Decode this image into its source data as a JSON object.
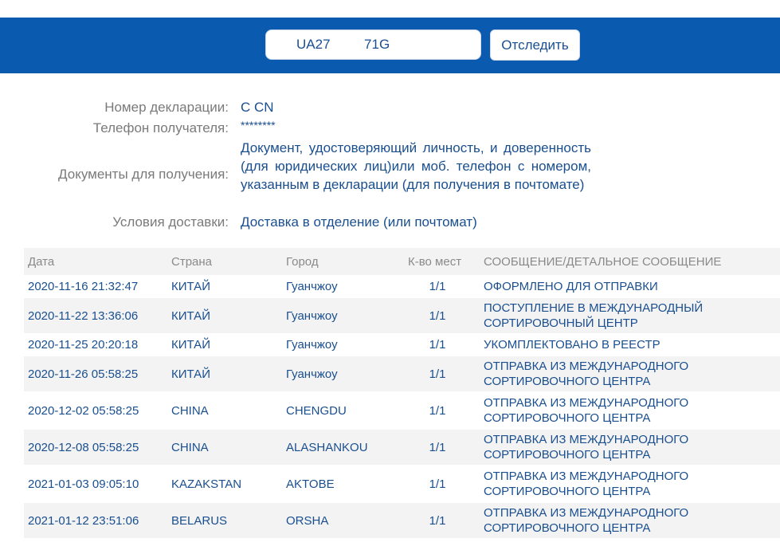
{
  "tracking": {
    "value": "UA27         71G",
    "button_label": "Отследить"
  },
  "info": {
    "declaration_label": "Номер декларации:",
    "declaration_value": "C           CN",
    "phone_label": "Телефон получателя:",
    "phone_value": "********",
    "documents_label": "Документы для получения:",
    "documents_value": "Документ, удостоверяющий личность, и доверенность (для юридических лиц)или моб. телефон с номером, указанным в декларации (для получения в почтомате)",
    "delivery_label": "Условия доставки:",
    "delivery_value": "Доставка в отделение (или почтомат)"
  },
  "table": {
    "headers": [
      "Дата",
      "Страна",
      "Город",
      "К-во мест",
      "СООБЩЕНИЕ/ДЕТАЛЬНОЕ СООБЩЕНИЕ"
    ],
    "rows": [
      {
        "date": "2020-11-16 21:32:47",
        "country": "КИТАЙ",
        "city": "Гуанчжоу",
        "qty": "1/1",
        "message": "ОФОРМЛЕНО ДЛЯ ОТПРАВКИ"
      },
      {
        "date": "2020-11-22 13:36:06",
        "country": "КИТАЙ",
        "city": "Гуанчжоу",
        "qty": "1/1",
        "message": "ПОСТУПЛЕНИЕ В МЕЖДУНАРОДНЫЙ СОРТИРОВОЧНЫЙ ЦЕНТР"
      },
      {
        "date": "2020-11-25 20:20:18",
        "country": "КИТАЙ",
        "city": "Гуанчжоу",
        "qty": "1/1",
        "message": "УКОМПЛЕКТОВАНО В РЕЕСТР"
      },
      {
        "date": "2020-11-26 05:58:25",
        "country": "КИТАЙ",
        "city": "Гуанчжоу",
        "qty": "1/1",
        "message": "ОТПРАВКА ИЗ МЕЖДУНАРОДНОГО СОРТИРОВОЧНОГО ЦЕНТРА"
      },
      {
        "date": "2020-12-02 05:58:25",
        "country": "CHINA",
        "city": "CHENGDU",
        "qty": "1/1",
        "message": "ОТПРАВКА ИЗ МЕЖДУНАРОДНОГО СОРТИРОВОЧНОГО ЦЕНТРА"
      },
      {
        "date": "2020-12-08 05:58:25",
        "country": "CHINA",
        "city": "ALASHANKOU",
        "qty": "1/1",
        "message": "ОТПРАВКА ИЗ МЕЖДУНАРОДНОГО СОРТИРОВОЧНОГО ЦЕНТРА"
      },
      {
        "date": "2021-01-03 09:05:10",
        "country": "KAZAKSTAN",
        "city": "AKTOBE",
        "qty": "1/1",
        "message": "ОТПРАВКА ИЗ МЕЖДУНАРОДНОГО СОРТИРОВОЧНОГО ЦЕНТРА"
      },
      {
        "date": "2021-01-12 23:51:06",
        "country": "BELARUS",
        "city": "ORSHA",
        "qty": "1/1",
        "message": "ОТПРАВКА ИЗ МЕЖДУНАРОДНОГО СОРТИРОВОЧНОГО ЦЕНТРА"
      }
    ]
  }
}
